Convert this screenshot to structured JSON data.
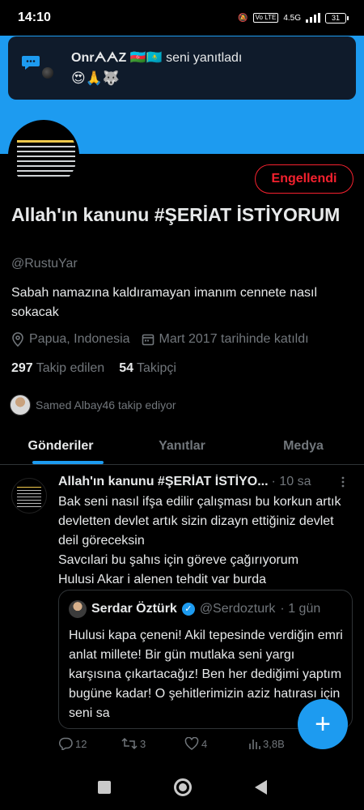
{
  "status_bar": {
    "time": "14:10",
    "volte": "Vo LTE",
    "network": "4.5G",
    "battery": "31"
  },
  "notification": {
    "name": "OnrᗅᗅZ",
    "flags": "🇦🇿🇰🇿",
    "action": "seni yanıtladı",
    "emojis": "😍🙏🐺"
  },
  "profile": {
    "block_label": "Engellendi",
    "name": "Allah'ın kanunu #ŞERİAT İSTİYORUM",
    "handle": "@RustuYar",
    "bio": "Sabah namazına kaldıramayan imanım cennete nasıl sokacak",
    "location": "Papua, Indonesia",
    "joined": "Mart 2017 tarihinde katıldı",
    "following_count": "297",
    "following_label": "Takip edilen",
    "followers_count": "54",
    "followers_label": "Takipçi",
    "followed_by": "Samed Albay46 takip ediyor"
  },
  "tabs": [
    {
      "label": "Gönderiler"
    },
    {
      "label": "Yanıtlar"
    },
    {
      "label": "Medya"
    }
  ],
  "tweet": {
    "author": "Allah'ın kanunu #ŞERİAT İSTİYO...",
    "time": "· 10 sa",
    "text": "Bak seni nasıl ifşa edilir çalışması bu korkun artık devletten devlet artık sizin dizayn ettiğiniz devlet deil göreceksin\nSavcılari bu şahıs için göreve çağırıyorum\nHulusi Akar i alenen tehdit var burda",
    "quote": {
      "name": "Serdar Öztürk",
      "handle": "@Serdozturk",
      "time": "· 1 gün",
      "text": "Hulusi kapa çeneni! Akil tepesinde verdiğin emri anlat millete! Bir gün mutlaka seni yargı karşısına çıkartacağız! Ben her dediğimi yaptım bugüne kadar! O şehitlerimizin aziz hatırası için seni sa"
    },
    "replies": "12",
    "retweets": "3",
    "likes": "4",
    "views": "3,8B"
  },
  "icons": {
    "location": "location-pin-icon",
    "calendar": "calendar-icon",
    "reply": "reply-icon",
    "retweet": "retweet-icon",
    "like": "heart-icon",
    "views": "views-icon"
  },
  "colors": {
    "accent": "#1d9bf0",
    "blocked": "#f4212e",
    "muted": "#71767b"
  }
}
